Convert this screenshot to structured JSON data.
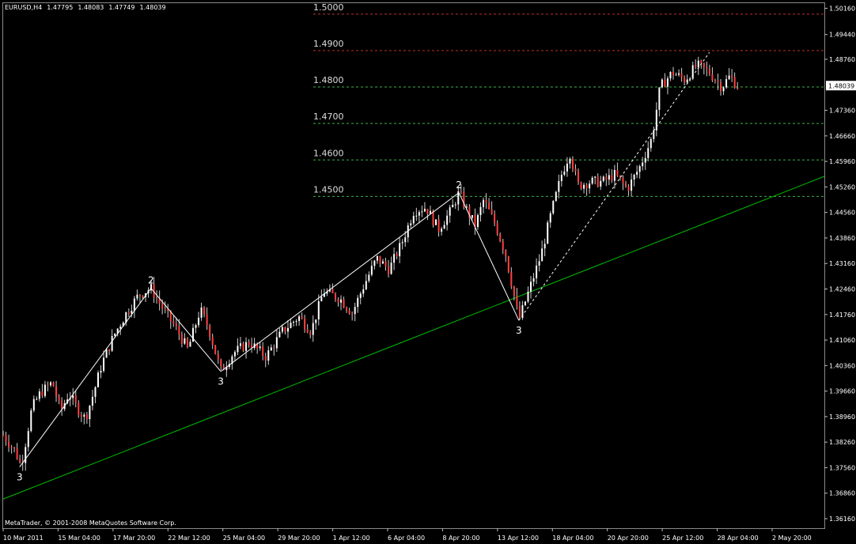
{
  "header": {
    "symbol": "EURUSD,H4",
    "open": "1.47795",
    "high": "1.48083",
    "low": "1.47749",
    "close": "1.48039"
  },
  "footer": {
    "copyright": "MetaTrader, © 2001-2008 MetaQuotes Software Corp."
  },
  "colors": {
    "background": "#000000",
    "bull_candle": "#ffffff",
    "bear_candle": "#ff4040",
    "trendline": "#00c000",
    "level_red": "#c03030",
    "level_green": "#3cb34a",
    "wave_line": "#ffffff",
    "current_price_bg": "#ffffff"
  },
  "chart_data": {
    "type": "candlestick",
    "symbol": "EURUSD",
    "timeframe": "H4",
    "ylim": [
      1.359,
      1.503
    ],
    "y_ticks": [
      "1.50160",
      "1.49440",
      "1.48760",
      "1.47360",
      "1.46660",
      "1.45960",
      "1.45260",
      "1.44560",
      "1.43860",
      "1.43160",
      "1.42460",
      "1.41760",
      "1.41060",
      "1.40360",
      "1.39660",
      "1.38960",
      "1.38260",
      "1.37560",
      "1.36860",
      "1.36160"
    ],
    "current_price": "1.48039",
    "x_ticks": [
      "10 Mar 2011",
      "15 Mar 04:00",
      "17 Mar 20:00",
      "22 Mar 12:00",
      "25 Mar 04:00",
      "29 Mar 20:00",
      "1 Apr 12:00",
      "6 Apr 04:00",
      "8 Apr 20:00",
      "13 Apr 12:00",
      "18 Apr 04:00",
      "20 Apr 20:00",
      "25 Apr 12:00",
      "28 Apr 04:00",
      "2 May 20:00"
    ],
    "levels": [
      {
        "label": "1.5000",
        "value": 1.5,
        "style": "red"
      },
      {
        "label": "1.4900",
        "value": 1.49,
        "style": "red"
      },
      {
        "label": "1.4800",
        "value": 1.48,
        "style": "green"
      },
      {
        "label": "1.4700",
        "value": 1.47,
        "style": "green"
      },
      {
        "label": "1.4600",
        "value": 1.46,
        "style": "green"
      },
      {
        "label": "1.4500",
        "value": 1.45,
        "style": "green"
      }
    ],
    "trendline": {
      "from": [
        0,
        1.367
      ],
      "to": [
        1.0,
        1.4555
      ]
    },
    "wave_points": [
      {
        "label": "3",
        "t": 0.02,
        "price": 1.3758
      },
      {
        "label": "2",
        "t": 0.18,
        "price": 1.4248
      },
      {
        "label": "3",
        "t": 0.265,
        "price": 1.402
      },
      {
        "label": "2",
        "t": 0.555,
        "price": 1.451
      },
      {
        "label": "3",
        "t": 0.628,
        "price": 1.416
      }
    ],
    "dashed_projection": [
      {
        "t": 0.628,
        "price": 1.416
      },
      {
        "t": 0.86,
        "price": 1.4895
      }
    ],
    "price_path": [
      [
        0.0,
        1.3845
      ],
      [
        0.015,
        1.38
      ],
      [
        0.022,
        1.376
      ],
      [
        0.035,
        1.392
      ],
      [
        0.045,
        1.396
      ],
      [
        0.06,
        1.399
      ],
      [
        0.07,
        1.391
      ],
      [
        0.08,
        1.396
      ],
      [
        0.09,
        1.392
      ],
      [
        0.1,
        1.389
      ],
      [
        0.11,
        1.396
      ],
      [
        0.12,
        1.404
      ],
      [
        0.135,
        1.412
      ],
      [
        0.15,
        1.418
      ],
      [
        0.165,
        1.423
      ],
      [
        0.18,
        1.4248
      ],
      [
        0.195,
        1.419
      ],
      [
        0.21,
        1.414
      ],
      [
        0.225,
        1.408
      ],
      [
        0.24,
        1.419
      ],
      [
        0.25,
        1.414
      ],
      [
        0.265,
        1.402
      ],
      [
        0.28,
        1.407
      ],
      [
        0.3,
        1.41
      ],
      [
        0.32,
        1.406
      ],
      [
        0.34,
        1.413
      ],
      [
        0.36,
        1.417
      ],
      [
        0.375,
        1.413
      ],
      [
        0.39,
        1.424
      ],
      [
        0.41,
        1.422
      ],
      [
        0.425,
        1.418
      ],
      [
        0.44,
        1.426
      ],
      [
        0.455,
        1.433
      ],
      [
        0.47,
        1.43
      ],
      [
        0.485,
        1.437
      ],
      [
        0.5,
        1.446
      ],
      [
        0.515,
        1.447
      ],
      [
        0.53,
        1.441
      ],
      [
        0.545,
        1.446
      ],
      [
        0.555,
        1.451
      ],
      [
        0.565,
        1.446
      ],
      [
        0.575,
        1.442
      ],
      [
        0.585,
        1.449
      ],
      [
        0.6,
        1.442
      ],
      [
        0.612,
        1.434
      ],
      [
        0.622,
        1.423
      ],
      [
        0.628,
        1.416
      ],
      [
        0.64,
        1.424
      ],
      [
        0.655,
        1.434
      ],
      [
        0.668,
        1.446
      ],
      [
        0.68,
        1.456
      ],
      [
        0.69,
        1.462
      ],
      [
        0.7,
        1.453
      ],
      [
        0.715,
        1.454
      ],
      [
        0.73,
        1.454
      ],
      [
        0.745,
        1.456
      ],
      [
        0.76,
        1.452
      ],
      [
        0.775,
        1.458
      ],
      [
        0.79,
        1.466
      ],
      [
        0.8,
        1.48
      ],
      [
        0.815,
        1.484
      ],
      [
        0.83,
        1.482
      ],
      [
        0.845,
        1.486
      ],
      [
        0.86,
        1.484
      ],
      [
        0.875,
        1.48
      ],
      [
        0.885,
        1.483
      ],
      [
        0.895,
        1.48
      ]
    ]
  }
}
